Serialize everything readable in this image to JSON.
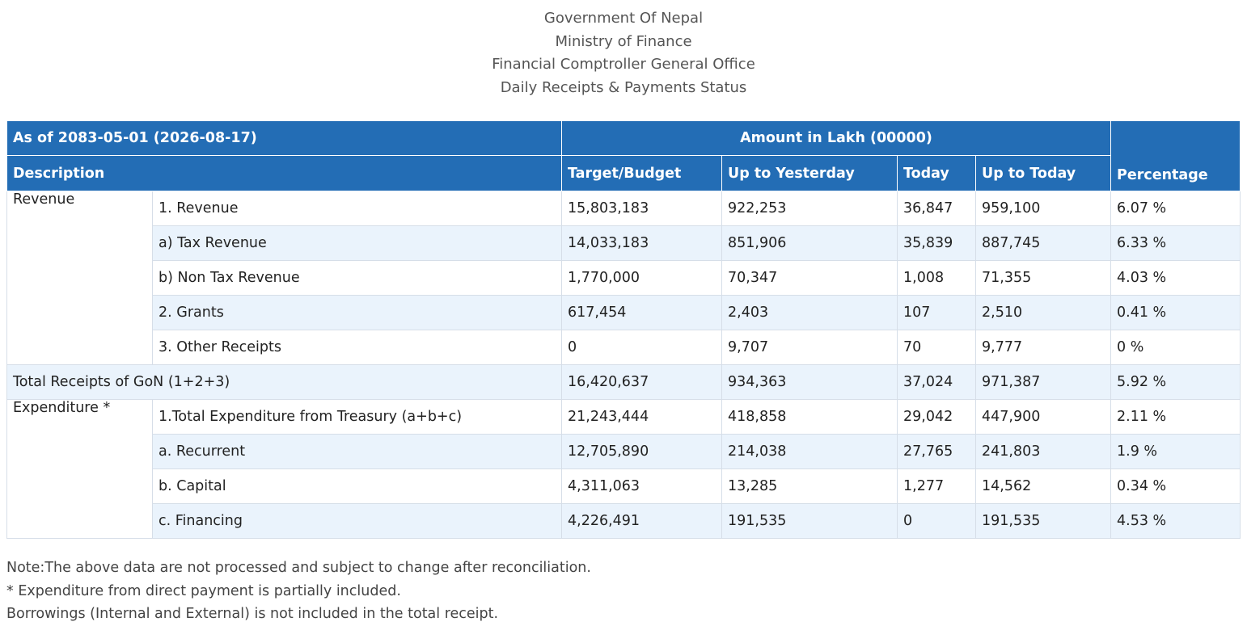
{
  "header": {
    "line1": "Government Of Nepal",
    "line2": "Ministry of Finance",
    "line3": "Financial Comptroller General Office",
    "line4": "Daily Receipts & Payments Status"
  },
  "table": {
    "as_of": "As of 2083-05-01 (2026-08-17)",
    "amount_unit": "Amount in Lakh (00000)",
    "columns": {
      "description": "Description",
      "target": "Target/Budget",
      "yesterday": "Up to Yesterday",
      "today": "Today",
      "up_today": "Up to Today",
      "percentage": "Percentage"
    },
    "groups": {
      "revenue": "Revenue",
      "total": "Total Receipts of GoN (1+2+3)",
      "expenditure": "Expenditure *"
    },
    "rows": [
      {
        "label": "1. Revenue",
        "target": "15,803,183",
        "yesterday": "922,253",
        "today": "36,847",
        "up_today": "959,100",
        "pct": "6.07 %"
      },
      {
        "label": "a) Tax Revenue",
        "target": "14,033,183",
        "yesterday": "851,906",
        "today": "35,839",
        "up_today": "887,745",
        "pct": "6.33 %"
      },
      {
        "label": "b) Non Tax Revenue",
        "target": "1,770,000",
        "yesterday": "70,347",
        "today": "1,008",
        "up_today": "71,355",
        "pct": "4.03 %"
      },
      {
        "label": "2. Grants",
        "target": "617,454",
        "yesterday": "2,403",
        "today": "107",
        "up_today": "2,510",
        "pct": "0.41 %"
      },
      {
        "label": "3. Other Receipts",
        "target": "0",
        "yesterday": "9,707",
        "today": "70",
        "up_today": "9,777",
        "pct": "0 %"
      },
      {
        "label": "",
        "target": "16,420,637",
        "yesterday": "934,363",
        "today": "37,024",
        "up_today": "971,387",
        "pct": "5.92 %"
      },
      {
        "label": "1.Total Expenditure from Treasury (a+b+c)",
        "target": "21,243,444",
        "yesterday": "418,858",
        "today": "29,042",
        "up_today": "447,900",
        "pct": "2.11 %"
      },
      {
        "label": "a. Recurrent",
        "target": "12,705,890",
        "yesterday": "214,038",
        "today": "27,765",
        "up_today": "241,803",
        "pct": "1.9 %"
      },
      {
        "label": "b. Capital",
        "target": "4,311,063",
        "yesterday": "13,285",
        "today": "1,277",
        "up_today": "14,562",
        "pct": "0.34 %"
      },
      {
        "label": "c. Financing",
        "target": "4,226,491",
        "yesterday": "191,535",
        "today": "0",
        "up_today": "191,535",
        "pct": "4.53 %"
      }
    ]
  },
  "notes": {
    "line1": "Note:The above data are not processed and subject to change after reconciliation.",
    "line2": "* Expenditure from direct payment is partially included.",
    "line3": "Borrowings (Internal and External) is not included in the total receipt."
  }
}
